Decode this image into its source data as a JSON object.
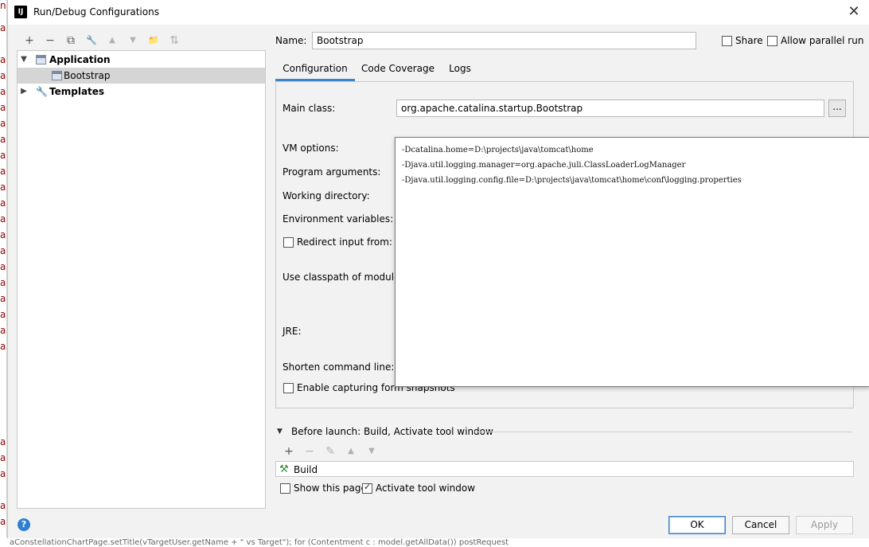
{
  "window": {
    "title": "Run/Debug Configurations",
    "app_icon_text": "IJ",
    "close_glyph": "✕"
  },
  "toolbar": {
    "add": "+",
    "remove": "−",
    "copy": "⧉",
    "edit": "🔧",
    "up": "▲",
    "down": "▼",
    "folder": "📁",
    "sort": "⇅"
  },
  "tree": {
    "application": "Application",
    "bootstrap": "Bootstrap",
    "templates": "Templates"
  },
  "name": {
    "label": "Name:",
    "value": "Bootstrap"
  },
  "share": {
    "label": "Share",
    "checked": false
  },
  "parallel": {
    "label": "Allow parallel run",
    "checked": false
  },
  "tabs": [
    {
      "label": "Configuration",
      "active": true
    },
    {
      "label": "Code Coverage",
      "active": false
    },
    {
      "label": "Logs",
      "active": false
    }
  ],
  "config": {
    "main_class_label": "Main class:",
    "main_class_value": "org.apache.catalina.startup.Bootstrap",
    "browse_label": "...",
    "vm_options_label": "VM options:",
    "program_args_label": "Program arguments:",
    "working_dir_label": "Working directory:",
    "env_vars_label": "Environment variables:",
    "redirect_label": "Redirect input from:",
    "classpath_label": "Use classpath of module:",
    "jre_label": "JRE:",
    "shorten_label": "Shorten command line:",
    "snapshots_label": "Enable capturing form snapshots",
    "vm_options_lines": [
      "-Dcatalina.home=D:\\projects\\java\\tomcat\\home",
      "-Djava.util.logging.manager=org.apache.juli.ClassLoaderLogManager",
      "-Djava.util.logging.config.file=D:\\projects\\java\\tomcat\\home\\conf\\logging.properties"
    ]
  },
  "before_launch": {
    "title": "Before launch: Build, Activate tool window",
    "items": [
      "Build"
    ],
    "show_page_label": "Show this page",
    "show_page_checked": false,
    "activate_label": "Activate tool window",
    "activate_checked": true
  },
  "buttons": {
    "ok": "OK",
    "cancel": "Cancel",
    "apply": "Apply",
    "help": "?"
  },
  "background": {
    "bottom_text": "aConstellationChartPage.setTitle(vTargetUser.getName + \" vs Target\"); for (Contentment c : model.getAllData()) postRequest"
  },
  "colors": {
    "accent": "#4083c9",
    "help": "#2f7fd1"
  }
}
